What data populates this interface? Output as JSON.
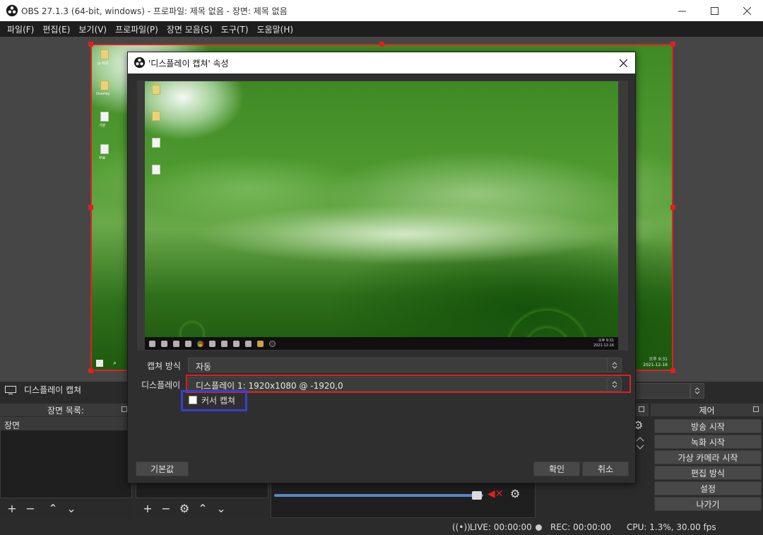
{
  "window": {
    "title": "OBS 27.1.3 (64-bit, windows) - 프로파일: 제목 없음 - 장면: 제목 없음",
    "minimize_icon": "minimize-icon",
    "maximize_icon": "maximize-icon",
    "close_icon": "close-icon"
  },
  "menu": [
    "파일(F)",
    "편집(E)",
    "보기(V)",
    "프로파일(P)",
    "장면 모음(S)",
    "도구(T)",
    "도움말(H)"
  ],
  "colors": {
    "accent_red": "#e02020",
    "accent_blue": "#3a3fd0",
    "background": "#2b2b2b"
  },
  "desktop": {
    "time": "오후 9:31",
    "date": "2021-12-16",
    "icon_labels": [
      "jp 레코",
      "Overlay",
      "기본",
      "무료"
    ]
  },
  "dialog": {
    "title": "'디스플레이 캡쳐' 속성",
    "capture_method_label": "캡쳐 방식",
    "capture_method_value": "자동",
    "display_label": "디스플레이",
    "display_value": "디스플레이 1: 1920x1080 @ -1920,0",
    "cursor_capture_label": "커서 캡쳐",
    "cursor_capture_checked": false,
    "defaults_button": "기본값",
    "ok_button": "확인",
    "cancel_button": "취소"
  },
  "source_bar": {
    "source_name": "디스플레이 캡쳐"
  },
  "docks": {
    "scenes_title": "장면 목록:",
    "scenes": [
      "장면"
    ],
    "controls_title": "제어",
    "controls": [
      "방송 시작",
      "녹화 시작",
      "가상 카메라 시작",
      "편집 방식",
      "설정",
      "나가기"
    ]
  },
  "status": {
    "live": "LIVE: 00:00:00",
    "rec": "REC: 00:00:00",
    "cpu": "CPU: 1.3%, 30.00 fps"
  }
}
